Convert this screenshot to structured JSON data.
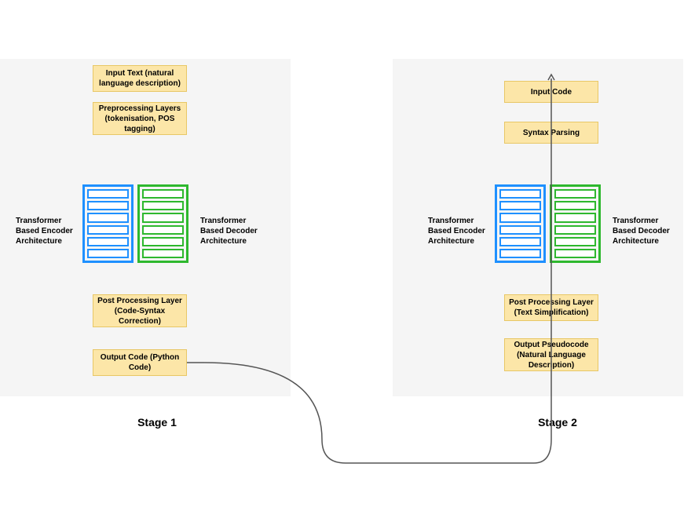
{
  "stage1": {
    "title": "Stage 1",
    "boxes": {
      "input": "Input Text (natural language description)",
      "pre": "Preprocessing Layers (tokenisation, POS tagging)",
      "post": "Post Processing Layer (Code-Syntax Correction)",
      "output": "Output Code (Python Code)"
    },
    "labels": {
      "encoder": "Transformer Based Encoder Architecture",
      "decoder": "Transformer Based Decoder Architecture"
    }
  },
  "stage2": {
    "title": "Stage 2",
    "boxes": {
      "input": "Input Code",
      "syntax": "Syntax Parsing",
      "post": "Post Processing Layer (Text Simplification)",
      "output": "Output Pseudocode (Natural Language Description)"
    },
    "labels": {
      "encoder": "Transformer Based Encoder Architecture",
      "decoder": "Transformer Based Decoder Architecture"
    }
  }
}
